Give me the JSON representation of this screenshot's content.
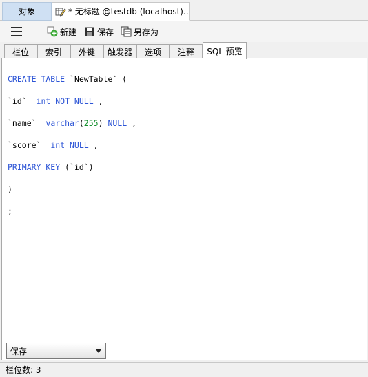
{
  "doc_tabs": {
    "objects_label": "对象",
    "active_title": "* 无标题 @testdb (localhost)..."
  },
  "toolbar": {
    "new_label": "新建",
    "save_label": "保存",
    "save_as_label": "另存为"
  },
  "property_tabs": [
    "栏位",
    "索引",
    "外键",
    "触发器",
    "选项",
    "注释",
    "SQL 预览"
  ],
  "selected_tab": "SQL 预览",
  "sql": {
    "l1_kw1": "CREATE TABLE",
    "l1_name": " `NewTable` (",
    "l2_col": "`id`  ",
    "l2_kw": "int NOT NULL",
    "l2_end": " ,",
    "l3_col": "`name`  ",
    "l3_kw": "varchar",
    "l3_p1": "(",
    "l3_num": "255",
    "l3_p2": ") ",
    "l3_kw2": "NULL",
    "l3_end": " ,",
    "l4_col": "`score`  ",
    "l4_kw": "int NULL",
    "l4_end": " ,",
    "l5_kw": "PRIMARY KEY",
    "l5_end": " (`id`)",
    "l6": ")",
    "l7": ";"
  },
  "dropdown": {
    "selected": "保存"
  },
  "status": {
    "text": "栏位数: 3"
  },
  "colors": {
    "keyword": "#2d55d6",
    "number": "#14902e",
    "objects_tab_bg": "#cfe0f3"
  },
  "icons": [
    "menu-icon",
    "edit-table-icon",
    "new-icon",
    "save-icon",
    "save-as-icon",
    "chevron-down-icon"
  ]
}
